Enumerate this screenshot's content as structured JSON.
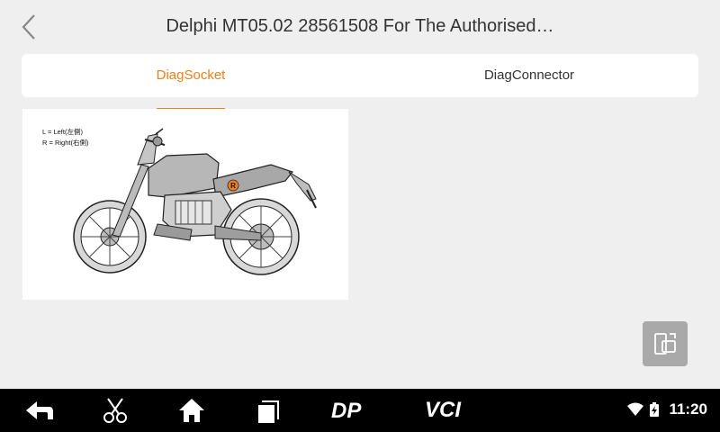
{
  "header": {
    "title": "Delphi MT05.02 28561508 For The Authorised…"
  },
  "tabs": [
    {
      "label": "DiagSocket",
      "active": true
    },
    {
      "label": "DiagConnector",
      "active": false
    }
  ],
  "diagram": {
    "legend_left": "L = Left(左側)",
    "legend_right": "R = Right(右側)",
    "marker": "R"
  },
  "navbar": {
    "icons": [
      "back-arrow-icon",
      "scissors-icon",
      "home-icon",
      "recent-apps-icon",
      "dp-logo-icon",
      "vci-logo-icon"
    ],
    "dp_label": "DP",
    "vci_label": "VCI"
  },
  "status": {
    "time": "11:20",
    "icons": [
      "wifi-icon",
      "battery-charging-icon"
    ]
  },
  "colors": {
    "accent": "#f07f1c",
    "background": "#efefef",
    "navbar": "#000000"
  }
}
